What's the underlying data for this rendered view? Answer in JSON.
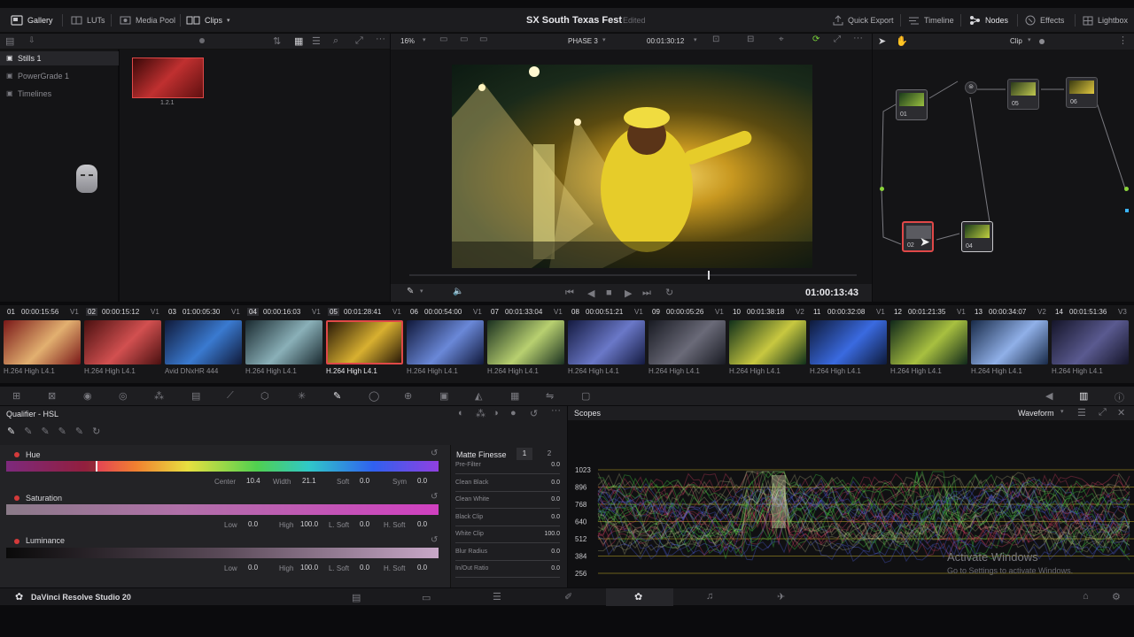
{
  "app": {
    "project_title": "SX South Texas Fest",
    "status": "Edited",
    "product": "DaVinci Resolve Studio 20"
  },
  "topbar": {
    "left": [
      "Gallery",
      "LUTs",
      "Media Pool",
      "Clips"
    ],
    "right": [
      "Quick Export",
      "Timeline",
      "Nodes",
      "Effects",
      "Lightbox"
    ]
  },
  "viewer": {
    "zoom": "16%",
    "timeline_name": "PHASE 3",
    "source_tc": "00:01:30:12",
    "current_tc": "01:00:13:43",
    "node_mode": "Clip"
  },
  "gallery": {
    "albums": [
      "Stills 1",
      "PowerGrade 1",
      "Timelines"
    ],
    "still_label": "1.2.1"
  },
  "clips": [
    {
      "num": "01",
      "tc": "00:00:15:56",
      "track": "V1",
      "codec": "H.264 High L4.1",
      "c1": "#7a1818",
      "c2": "#e2b070"
    },
    {
      "num": "02",
      "tc": "00:00:15:12",
      "track": "V1",
      "codec": "H.264 High L4.1",
      "c1": "#4a1010",
      "c2": "#d25050"
    },
    {
      "num": "03",
      "tc": "01:00:05:30",
      "track": "V1",
      "codec": "Avid DNxHR 444",
      "c1": "#101a3a",
      "c2": "#3a7ad0"
    },
    {
      "num": "04",
      "tc": "00:00:16:03",
      "track": "V1",
      "codec": "H.264 High L4.1",
      "c1": "#1a2a30",
      "c2": "#8ab0b8"
    },
    {
      "num": "05",
      "tc": "00:01:28:41",
      "track": "V1",
      "codec": "H.264 High L4.1",
      "c1": "#2a1a08",
      "c2": "#d8b030"
    },
    {
      "num": "06",
      "tc": "00:00:54:00",
      "track": "V1",
      "codec": "H.264 High L4.1",
      "c1": "#10183a",
      "c2": "#6a88d8"
    },
    {
      "num": "07",
      "tc": "00:01:33:04",
      "track": "V1",
      "codec": "H.264 High L4.1",
      "c1": "#1a3020",
      "c2": "#b8d070"
    },
    {
      "num": "08",
      "tc": "00:00:51:21",
      "track": "V1",
      "codec": "H.264 High L4.1",
      "c1": "#141a40",
      "c2": "#6a78c8"
    },
    {
      "num": "09",
      "tc": "00:00:05:26",
      "track": "V1",
      "codec": "H.264 High L4.1",
      "c1": "#181a22",
      "c2": "#6a6a78"
    },
    {
      "num": "10",
      "tc": "00:01:38:18",
      "track": "V2",
      "codec": "H.264 High L4.1",
      "c1": "#10301a",
      "c2": "#c8c840"
    },
    {
      "num": "11",
      "tc": "00:00:32:08",
      "track": "V1",
      "codec": "H.264 High L4.1",
      "c1": "#0e1a3a",
      "c2": "#3a6ae0"
    },
    {
      "num": "12",
      "tc": "00:01:21:35",
      "track": "V1",
      "codec": "H.264 High L4.1",
      "c1": "#10281a",
      "c2": "#a8c040"
    },
    {
      "num": "13",
      "tc": "00:00:34:07",
      "track": "V2",
      "codec": "H.264 High L4.1",
      "c1": "#182a48",
      "c2": "#90b0e8"
    },
    {
      "num": "14",
      "tc": "00:01:51:36",
      "track": "V3",
      "codec": "H.264 High L4.1",
      "c1": "#141428",
      "c2": "#5a5a90"
    }
  ],
  "selected_clip": 4,
  "nodes": [
    "01",
    "02",
    "04",
    "05",
    "06"
  ],
  "qualifier": {
    "title": "Qualifier - HSL",
    "hue": {
      "label": "Hue",
      "center_label": "Center",
      "center": "10.4",
      "width_label": "Width",
      "width": "21.1",
      "soft_label": "Soft",
      "soft": "0.0",
      "sym_label": "Sym",
      "sym": "0.0"
    },
    "saturation": {
      "label": "Saturation",
      "low_label": "Low",
      "low": "0.0",
      "high_label": "High",
      "high": "100.0",
      "lsoft_label": "L. Soft",
      "lsoft": "0.0",
      "hsoft_label": "H. Soft",
      "hsoft": "0.0"
    },
    "luminance": {
      "label": "Luminance",
      "low_label": "Low",
      "low": "0.0",
      "high_label": "High",
      "high": "100.0",
      "lsoft_label": "L. Soft",
      "lsoft": "0.0",
      "hsoft_label": "H. Soft",
      "hsoft": "0.0"
    }
  },
  "matte_finesse": {
    "title": "Matte Finesse",
    "tab1": "1",
    "tab2": "2",
    "rows": [
      {
        "label": "Pre-Filter",
        "value": "0.0"
      },
      {
        "label": "Clean Black",
        "value": "0.0"
      },
      {
        "label": "Clean White",
        "value": "0.0"
      },
      {
        "label": "Black Clip",
        "value": "0.0"
      },
      {
        "label": "White Clip",
        "value": "100.0"
      },
      {
        "label": "Blur Radius",
        "value": "0.0"
      },
      {
        "label": "In/Out Ratio",
        "value": "0.0"
      }
    ]
  },
  "scopes": {
    "title": "Scopes",
    "mode": "Waveform",
    "ticks": [
      "1023",
      "896",
      "768",
      "640",
      "512",
      "384",
      "256"
    ]
  },
  "watermark": {
    "line1": "Activate Windows",
    "line2": "Go to Settings to activate Windows."
  },
  "colors": {
    "accent": "#e04848",
    "panel": "#1e1e21",
    "bg": "#141416",
    "node_green": "#8ad43a",
    "node_blue": "#3ab4ff"
  }
}
